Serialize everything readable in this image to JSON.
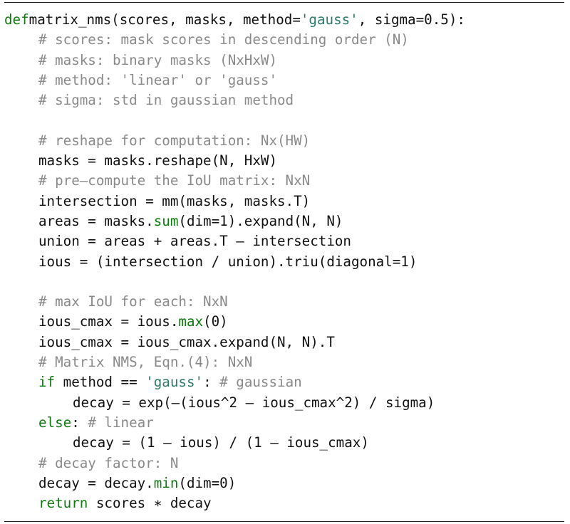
{
  "lines": [
    {
      "indent": 0,
      "parts": [
        [
          "kw",
          "def"
        ],
        [
          "",
          "matrix_nms(scores, masks, method="
        ],
        [
          "str",
          "'gauss'"
        ],
        [
          "",
          ", sigma=0.5):"
        ]
      ]
    },
    {
      "indent": 1,
      "parts": [
        [
          "cm",
          "# scores: mask scores in descending order (N)"
        ]
      ]
    },
    {
      "indent": 1,
      "parts": [
        [
          "cm",
          "# masks: binary masks (NxHxW)"
        ]
      ]
    },
    {
      "indent": 1,
      "parts": [
        [
          "cm",
          "# method: 'linear' or 'gauss'"
        ]
      ]
    },
    {
      "indent": 1,
      "parts": [
        [
          "cm",
          "# sigma: std in gaussian method"
        ]
      ]
    },
    {
      "indent": 0,
      "parts": []
    },
    {
      "indent": 1,
      "parts": [
        [
          "cm",
          "# reshape for computation: Nx(HW)"
        ]
      ]
    },
    {
      "indent": 1,
      "parts": [
        [
          "",
          "masks = masks.reshape(N, HxW)"
        ]
      ]
    },
    {
      "indent": 1,
      "parts": [
        [
          "cm",
          "# pre—compute the IoU matrix: NxN"
        ]
      ]
    },
    {
      "indent": 1,
      "parts": [
        [
          "",
          "intersection = mm(masks, masks.T)"
        ]
      ]
    },
    {
      "indent": 1,
      "parts": [
        [
          "",
          "areas = masks."
        ],
        [
          "fn",
          "sum"
        ],
        [
          "",
          "(dim=1).expand(N, N)"
        ]
      ]
    },
    {
      "indent": 1,
      "parts": [
        [
          "",
          "union = areas + areas.T — intersection"
        ]
      ]
    },
    {
      "indent": 1,
      "parts": [
        [
          "",
          "ious = (intersection / union).triu(diagonal=1)"
        ]
      ]
    },
    {
      "indent": 0,
      "parts": []
    },
    {
      "indent": 1,
      "parts": [
        [
          "cm",
          "# max IoU for each: NxN"
        ]
      ]
    },
    {
      "indent": 1,
      "parts": [
        [
          "",
          "ious_cmax = ious."
        ],
        [
          "fn",
          "max"
        ],
        [
          "",
          "(0)"
        ]
      ]
    },
    {
      "indent": 1,
      "parts": [
        [
          "",
          "ious_cmax = ious_cmax.expand(N, N).T"
        ]
      ]
    },
    {
      "indent": 1,
      "parts": [
        [
          "cm",
          "# Matrix NMS, Eqn.(4): NxN"
        ]
      ]
    },
    {
      "indent": 1,
      "parts": [
        [
          "kw",
          "if"
        ],
        [
          "",
          " method == "
        ],
        [
          "str",
          "'gauss'"
        ],
        [
          "",
          ": "
        ],
        [
          "cm",
          "# gaussian"
        ]
      ]
    },
    {
      "indent": 2,
      "parts": [
        [
          "",
          "decay = exp(—(ious^2 — ious_cmax^2) / sigma)"
        ]
      ]
    },
    {
      "indent": 1,
      "parts": [
        [
          "kw",
          "else"
        ],
        [
          "",
          ": "
        ],
        [
          "cm",
          "# linear"
        ]
      ]
    },
    {
      "indent": 2,
      "parts": [
        [
          "",
          "decay = (1 — ious) / (1 — ious_cmax)"
        ]
      ]
    },
    {
      "indent": 1,
      "parts": [
        [
          "cm",
          "# decay factor: N"
        ]
      ]
    },
    {
      "indent": 1,
      "parts": [
        [
          "",
          "decay = decay."
        ],
        [
          "fn",
          "min"
        ],
        [
          "",
          "(dim=0)"
        ]
      ]
    },
    {
      "indent": 1,
      "parts": [
        [
          "kw",
          "return"
        ],
        [
          "",
          " scores ∗ decay"
        ]
      ]
    }
  ]
}
